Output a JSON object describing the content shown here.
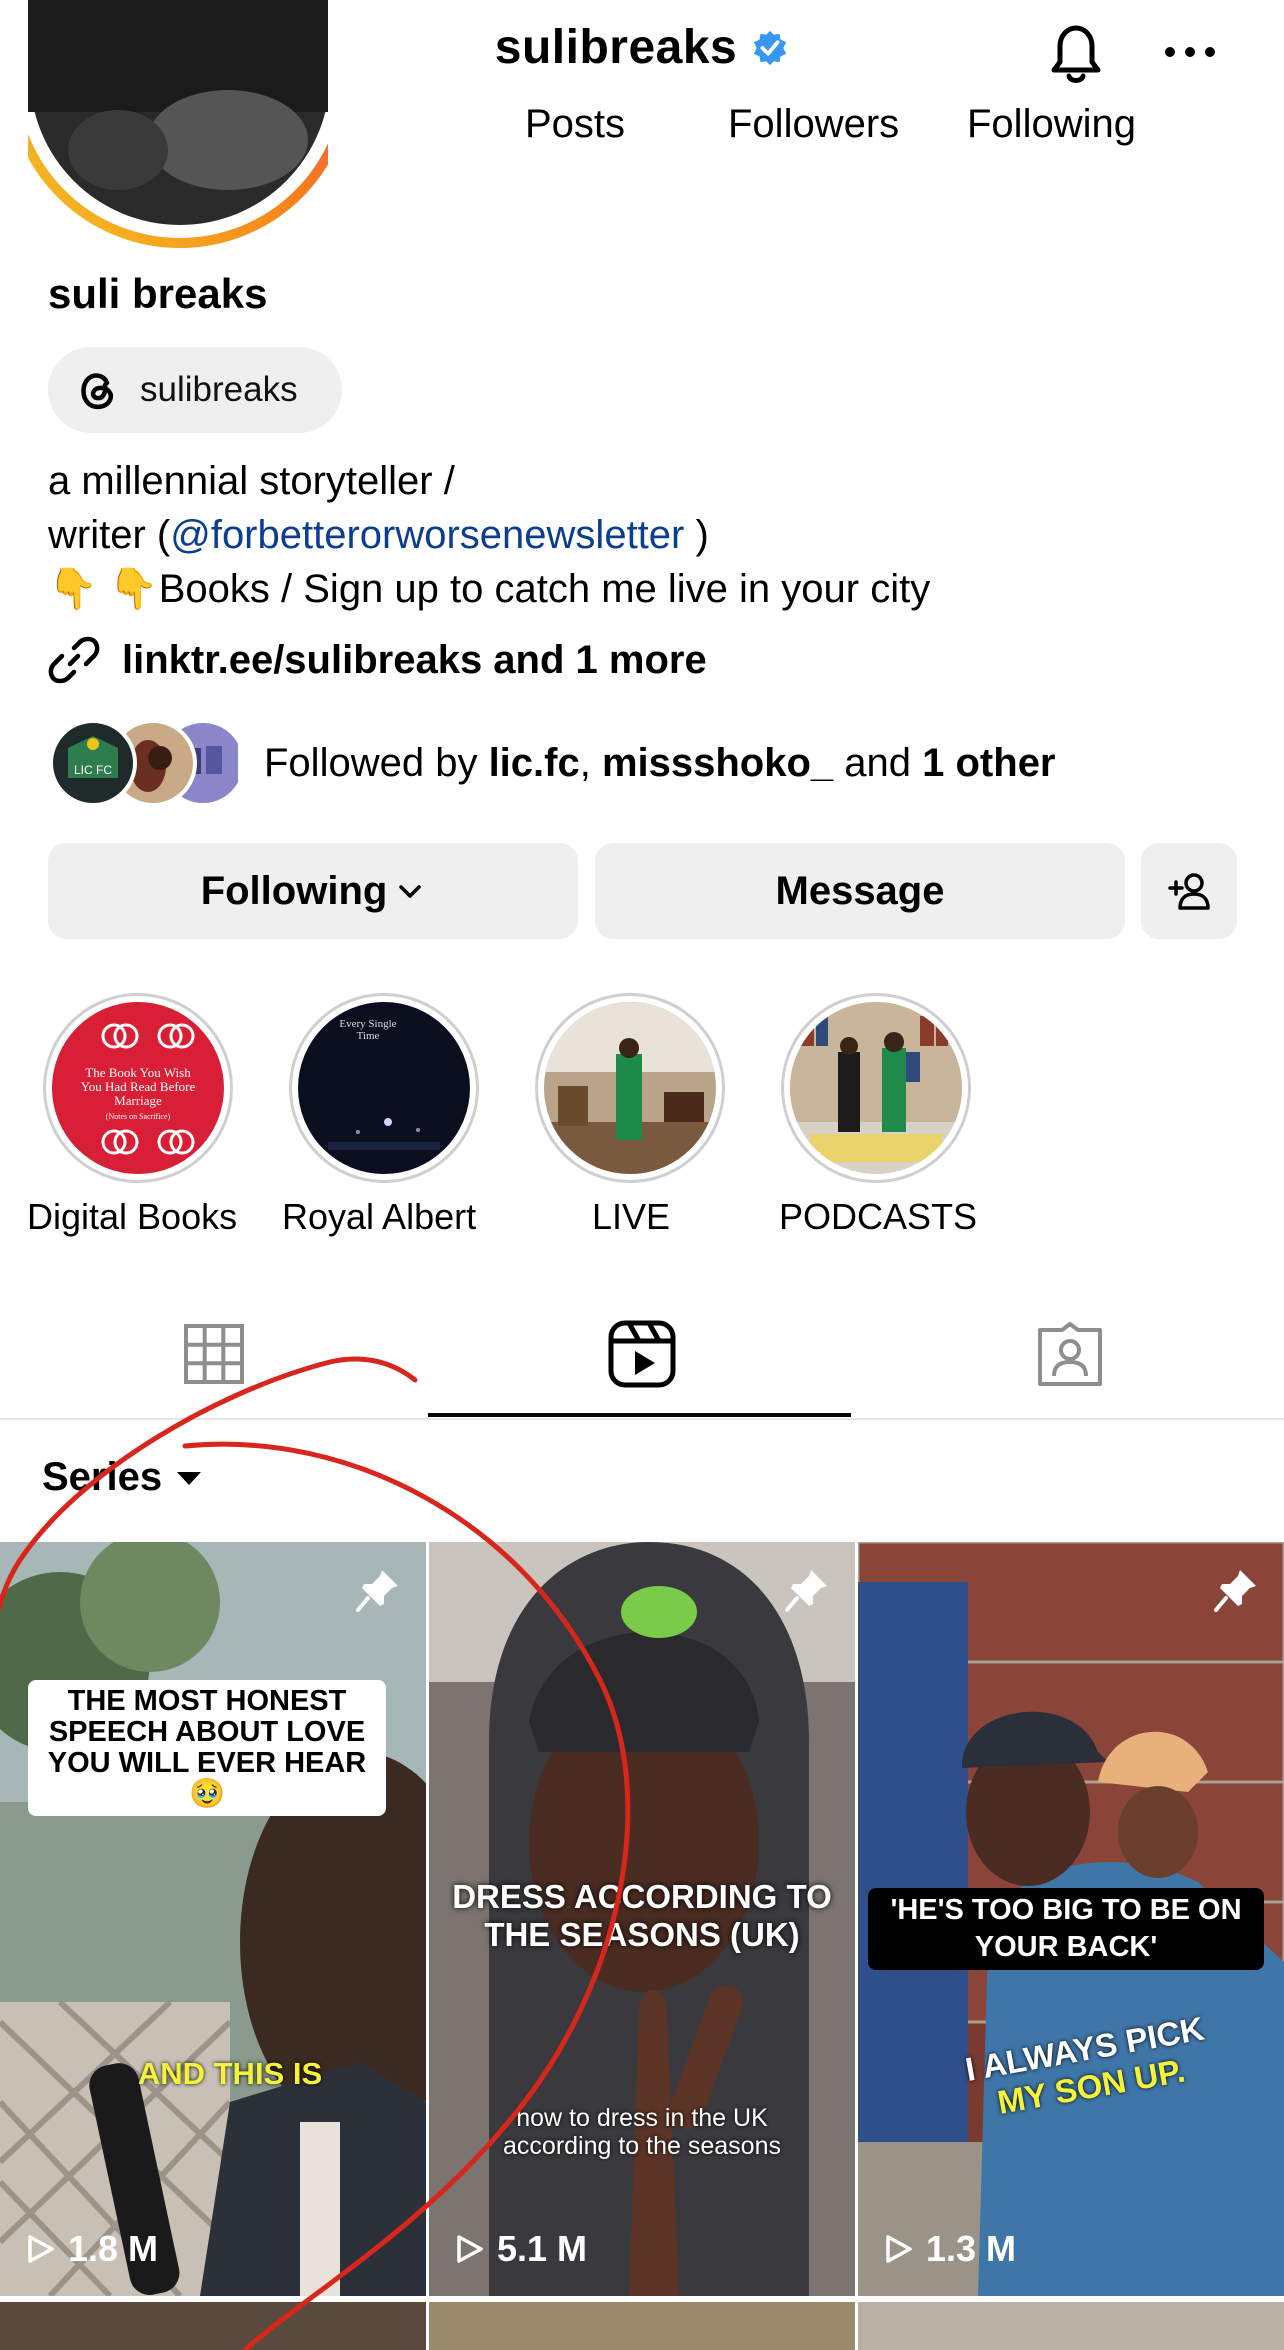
{
  "header": {
    "username": "sulibreaks"
  },
  "profile": {
    "stats": [
      "Posts",
      "Followers",
      "Following"
    ],
    "display_name": "suli breaks",
    "threads_handle": "sulibreaks",
    "bio_line1": "a millennial storyteller /",
    "bio_line2_prefix": "writer (",
    "bio_mention": "@forbetterorworsenewsletter",
    "bio_line2_suffix": " )",
    "bio_line3_emoji": "👇 👇",
    "bio_line3_text": "Books / Sign up to catch me live in your city",
    "link_text": "linktr.ee/sulibreaks and 1 more",
    "followed_by_prefix": "Followed by ",
    "followed_user1": "lic.fc",
    "followed_sep": ", ",
    "followed_user2": "missshoko_",
    "followed_and": " and ",
    "followed_other": "1 other"
  },
  "actions": {
    "following": "Following",
    "message": "Message"
  },
  "highlights": [
    {
      "label": "Digital Books"
    },
    {
      "label": "Royal Albert"
    },
    {
      "label": "LIVE"
    },
    {
      "label": "PODCASTS"
    }
  ],
  "highlight_book_text": "The Book You Wish You Had Read Before Marriage",
  "highlight_book_sub": "(Notes on Sacrifice)",
  "highlight_royal_text": "Every Single Time",
  "series_label": "Series",
  "reels": [
    {
      "caption_top": "THE MOST HONEST SPEECH ABOUT LOVE YOU WILL EVER HEAR🥹",
      "caption_bottom": "AND THIS IS",
      "views": "1.8 M"
    },
    {
      "caption_top": "DRESS ACCORDING TO THE SEASONS (UK)",
      "caption_bottom": "how to dress in the UK according to the seasons",
      "views": "5.1 M"
    },
    {
      "caption_top": "'HE'S TOO BIG TO BE ON YOUR BACK'",
      "caption_bottom_1": "I ALWAYS PICK",
      "caption_bottom_2": "MY SON UP.",
      "views": "1.3 M"
    }
  ],
  "colors": {
    "mention": "#0b3d91",
    "verified": "#3897f0",
    "caption_yellow": "#f5f23a",
    "annotation": "#d9261c"
  }
}
